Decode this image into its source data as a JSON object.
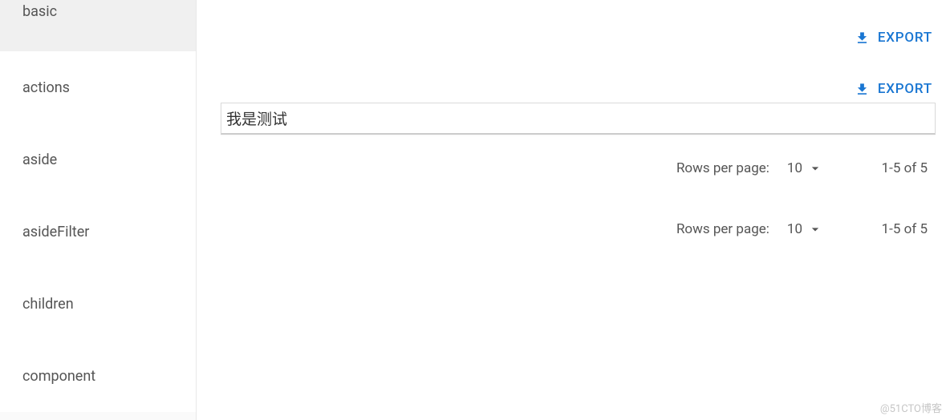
{
  "sidebar": {
    "items": [
      {
        "label": "basic"
      },
      {
        "label": "actions"
      },
      {
        "label": "aside"
      },
      {
        "label": "asideFilter"
      },
      {
        "label": "children"
      },
      {
        "label": "component"
      }
    ]
  },
  "toolbar": {
    "export_label": "EXPORT"
  },
  "input": {
    "value": "我是测试"
  },
  "pagination": {
    "rows_label": "Rows per page:",
    "per_page": "10",
    "range": "1-5 of 5"
  },
  "watermark": "@51CTO博客"
}
